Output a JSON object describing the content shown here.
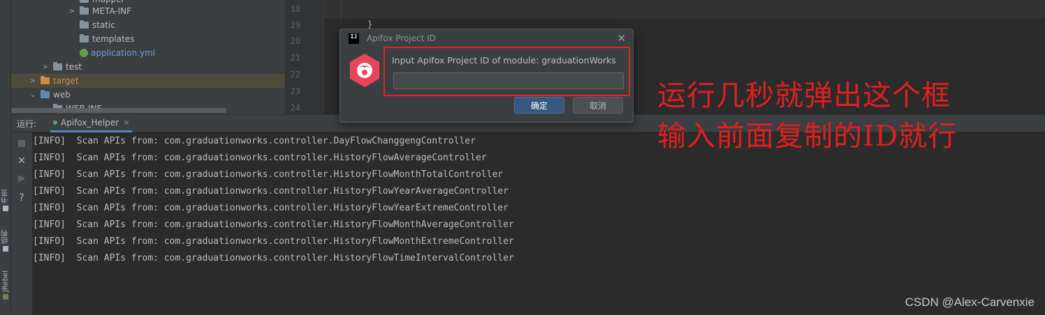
{
  "side_strip": {
    "labels": [
      "书签",
      "结构",
      "JRebel"
    ]
  },
  "project_tree": {
    "items": [
      {
        "label": "mapper",
        "icon": "folder-icon"
      },
      {
        "label": "META-INF",
        "icon": "folder-icon"
      },
      {
        "label": "static",
        "icon": "folder-icon"
      },
      {
        "label": "templates",
        "icon": "folder-icon"
      },
      {
        "label": "application.yml",
        "icon": "spring-yml-icon"
      },
      {
        "label": "test",
        "icon": "folder-icon"
      },
      {
        "label": "target",
        "icon": "excluded-folder-icon"
      },
      {
        "label": "web",
        "icon": "web-folder-icon"
      },
      {
        "label": "WEB-INF",
        "icon": "folder-icon"
      }
    ]
  },
  "editor": {
    "line_numbers": [
      "18",
      "19",
      "20",
      "21",
      "22",
      "23",
      "24"
    ],
    "code_fragment": "}"
  },
  "run_panel": {
    "label": "运行:",
    "tab_label": "Apifox_Helper",
    "tab_close": "×",
    "toolbar_icons": [
      "stop-icon",
      "close-icon",
      "rerun-icon",
      "help-icon"
    ],
    "toolbar_glyphs": {
      "close": "✕",
      "rerun": "▶",
      "help": "?"
    },
    "log_lines": [
      "[INFO]  Scan APIs from: com.graduationworks.controller.DayFlowChanggengController",
      "[INFO]  Scan APIs from: com.graduationworks.controller.HistoryFlowAverageController",
      "[INFO]  Scan APIs from: com.graduationworks.controller.HistoryFlowMonthTotalController",
      "[INFO]  Scan APIs from: com.graduationworks.controller.HistoryFlowYearAverageController",
      "[INFO]  Scan APIs from: com.graduationworks.controller.HistoryFlowYearExtremeController",
      "[INFO]  Scan APIs from: com.graduationworks.controller.HistoryFlowMonthAverageController",
      "[INFO]  Scan APIs from: com.graduationworks.controller.HistoryFlowMonthExtremeController",
      "[INFO]  Scan APIs from: com.graduationworks.controller.HistoryFlowTimeIntervalController"
    ]
  },
  "dialog": {
    "ide_badge": "IJ",
    "title": "Apifox Project ID",
    "close_glyph": "✕",
    "prompt": "Input Apifox Project ID of module: graduationWorks",
    "input_value": "",
    "ok_label": "确定",
    "cancel_label": "取消",
    "highlight_color": "#e0242a"
  },
  "annotation": {
    "line1": "运行几秒就弹出这个框",
    "line2": "输入前面复制的ID就行",
    "color": "#e01f1f"
  },
  "watermark": "CSDN @Alex-Carvenxie"
}
